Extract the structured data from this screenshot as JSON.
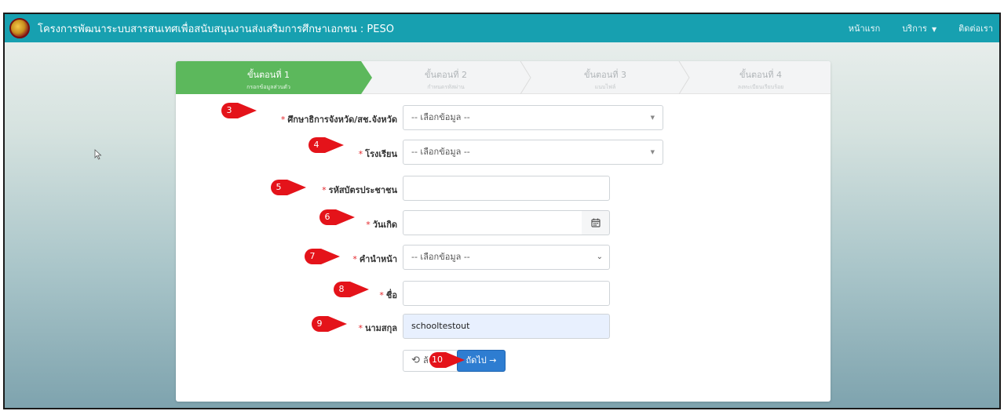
{
  "navbar": {
    "title": "โครงการพัฒนาระบบสารสนเทศเพื่อสนับสนุนงานส่งเสริมการศึกษาเอกชน : PESO",
    "links": {
      "home": "หน้าแรก",
      "services": "บริการ",
      "contact": "ติดต่อเรา"
    }
  },
  "steps": [
    {
      "title": "ขั้นตอนที่ 1",
      "subtitle": "กรอกข้อมูลส่วนตัว"
    },
    {
      "title": "ขั้นตอนที่ 2",
      "subtitle": "กำหนดรหัสผ่าน"
    },
    {
      "title": "ขั้นตอนที่ 3",
      "subtitle": "แนบไฟล์"
    },
    {
      "title": "ขั้นตอนที่ 4",
      "subtitle": "ลงทะเบียนเรียบร้อย"
    }
  ],
  "form": {
    "province_office": {
      "label": "ศึกษาธิการจังหวัด/สช.จังหวัด",
      "value": "-- เลือกข้อมูล --"
    },
    "school": {
      "label": "โรงเรียน",
      "value": "-- เลือกข้อมูล --"
    },
    "citizen_id": {
      "label": "รหัสบัตรประชาชน",
      "value": ""
    },
    "birthdate": {
      "label": "วันเกิด",
      "value": ""
    },
    "prefix": {
      "label": "คำนำหน้า",
      "value": "-- เลือกข้อมูล --"
    },
    "first_name": {
      "label": "ชื่อ",
      "value": ""
    },
    "last_name": {
      "label": "นามสกุล",
      "value": "schooltestout"
    },
    "required_mark": "*"
  },
  "buttons": {
    "reset_label": "ล้าง",
    "next_label": "ถัดไป"
  },
  "markers": [
    "3",
    "4",
    "5",
    "6",
    "7",
    "8",
    "9",
    "10"
  ],
  "icons": {
    "reset": "undo-icon",
    "next": "arrow-right-icon",
    "calendar": "calendar-icon"
  },
  "colors": {
    "navbar": "#17a0b0",
    "active_step": "#5cb85c",
    "marker": "#e4131a",
    "next_button": "#2e7dd1",
    "required": "#e4262b"
  }
}
